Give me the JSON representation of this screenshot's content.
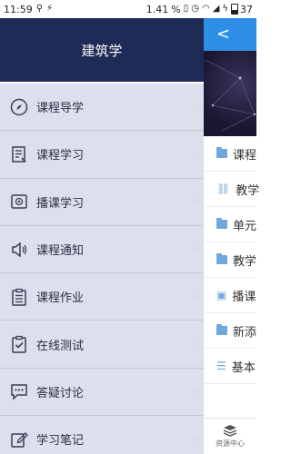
{
  "status_bar": {
    "time": "11:59",
    "speed": "1.41",
    "speed_unit": "%",
    "battery": "37"
  },
  "drawer": {
    "title": "建筑学",
    "items": [
      {
        "label": "课程导学",
        "icon": "compass-icon"
      },
      {
        "label": "课程学习",
        "icon": "notebook-icon"
      },
      {
        "label": "播课学习",
        "icon": "video-icon"
      },
      {
        "label": "课程通知",
        "icon": "speaker-icon"
      },
      {
        "label": "课程作业",
        "icon": "clipboard-icon"
      },
      {
        "label": "在线测试",
        "icon": "check-clipboard-icon"
      },
      {
        "label": "答疑讨论",
        "icon": "chat-icon"
      },
      {
        "label": "学习笔记",
        "icon": "edit-icon"
      }
    ]
  },
  "background_page": {
    "list": [
      {
        "text": "课程"
      },
      {
        "text": "教学"
      },
      {
        "text": "单元"
      },
      {
        "text": "教学"
      },
      {
        "text": "播课"
      },
      {
        "text": "新添"
      },
      {
        "text": "基本"
      }
    ],
    "bottom_tab": "资源中心"
  },
  "colors": {
    "drawer_header": "#1f2a56",
    "drawer_bg": "#dcdfec",
    "topbar_blue": "#2f8fe6"
  }
}
